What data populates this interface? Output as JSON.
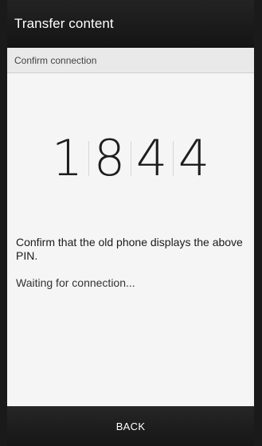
{
  "app_bar": {
    "title": "Transfer content"
  },
  "section": {
    "title": "Confirm connection"
  },
  "pin": {
    "digits": [
      "1",
      "8",
      "4",
      "4"
    ]
  },
  "instruction": "Confirm that the old phone displays the above PIN.",
  "status": "Waiting for connection...",
  "bottom_bar": {
    "back_label": "BACK"
  }
}
